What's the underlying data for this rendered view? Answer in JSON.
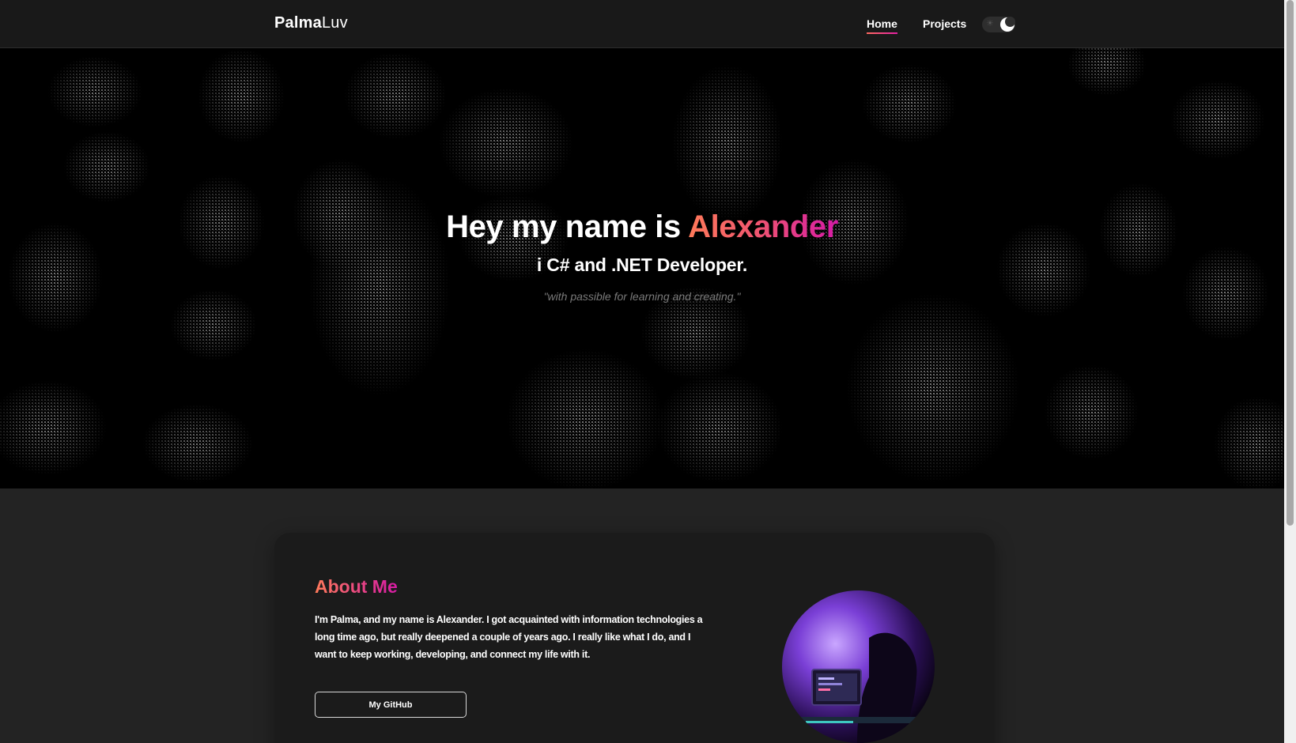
{
  "nav": {
    "brand_bold": "Palma",
    "brand_light": "Luv",
    "links": [
      {
        "label": "Home",
        "active": true
      },
      {
        "label": "Projects",
        "active": false
      }
    ],
    "theme_toggle_icons": [
      "sun-icon",
      "moon-icon"
    ]
  },
  "hero": {
    "title_prefix": "Hey my name is ",
    "title_name": "Alexander",
    "subtitle": "i C# and .NET Developer.",
    "quote": "\"with passible for learning and creating.\""
  },
  "about": {
    "title": "About Me",
    "text": "I'm Palma, and my name is Alexander. I got acquainted with information technologies a long time ago, but really deepened a couple of years ago. I really like what I do, and I want to keep working, developing, and connect my life with it.",
    "button_label": "My GitHub"
  },
  "colors": {
    "accent_start": "#ff7a5a",
    "accent_end": "#d61aa6",
    "nav_bg": "#191919",
    "page_bg": "#232323",
    "card_bg": "#1b1b1b"
  }
}
